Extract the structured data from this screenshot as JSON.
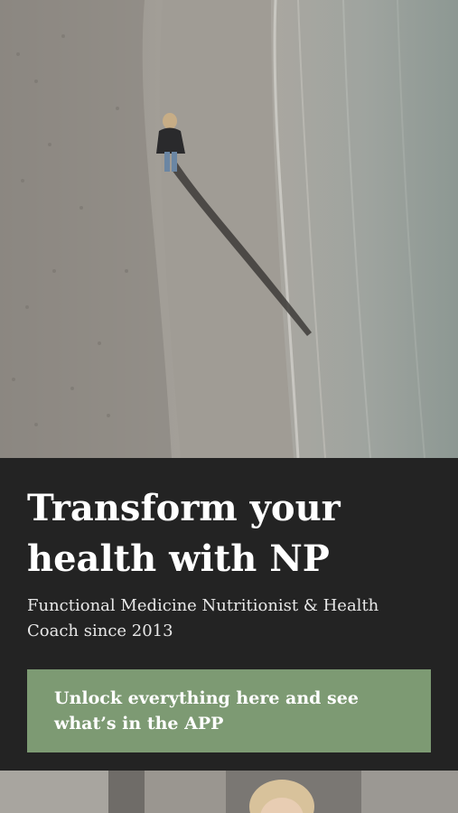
{
  "hero": {
    "image": "aerial-beach-photo"
  },
  "intro": {
    "headline": "Transform your health with NP",
    "subtitle": "Functional Medicine Nutritionist & Health Coach since 2013",
    "cta_label": "Unlock everything here and see what’s in the APP"
  },
  "next_section": {
    "image": "portrait-photo"
  },
  "colors": {
    "panel_background": "#232323",
    "cta_background": "#7d9a73",
    "text": "#ffffff"
  }
}
